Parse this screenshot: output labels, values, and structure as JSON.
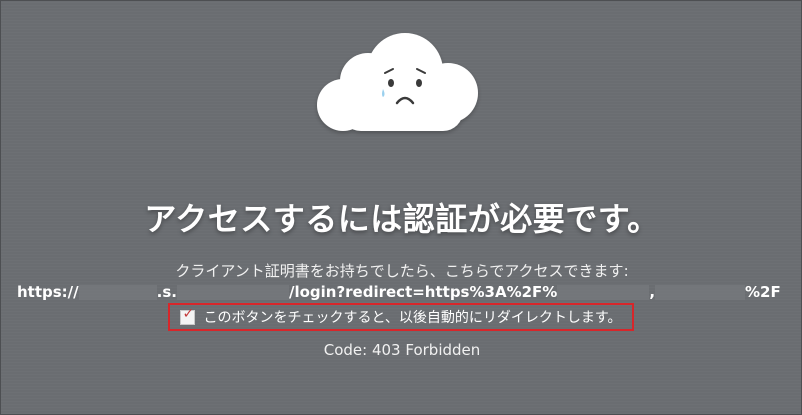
{
  "page": {
    "title": "アクセスするには認証が必要です。",
    "prompt": "クライアント証明書をお持ちでしたら、こちらでアクセスできます:",
    "url_parts": [
      "https://",
      ".s.",
      "/login?redirect=https%3A%2F%",
      ",",
      "%2F"
    ],
    "checkbox": {
      "label": "このボタンをチェックすると、以後自動的にリダイレクトします。",
      "checked": true
    },
    "status_code": "Code: 403 Forbidden"
  },
  "colors": {
    "background": "#6a6d71",
    "highlight_border": "#d8262a",
    "text": "#ffffff"
  },
  "icons": {
    "hero": "sad-cloud-icon",
    "checkbox": "checkmark-icon"
  }
}
